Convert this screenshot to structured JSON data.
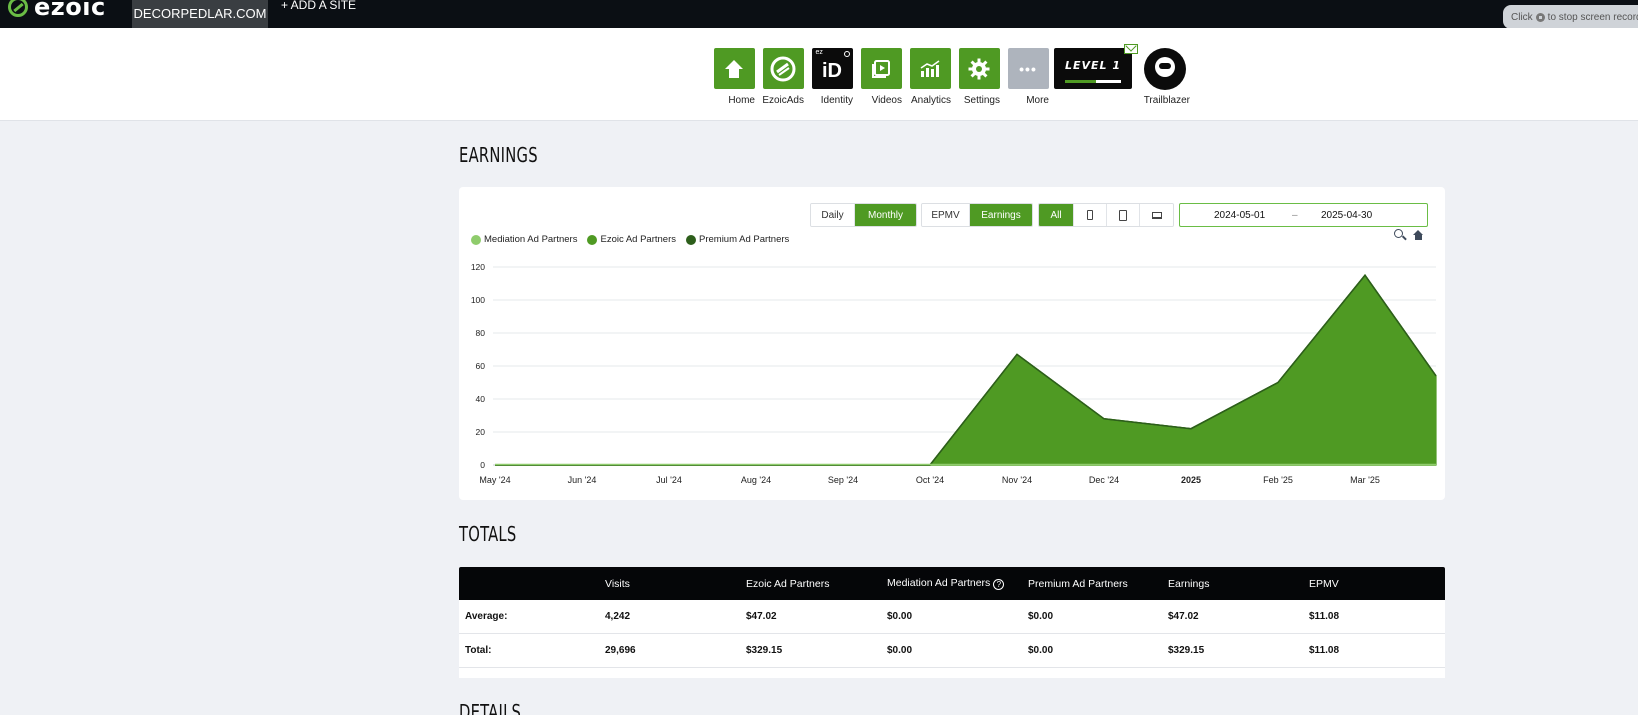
{
  "topbar": {
    "logo_text": "ezoic",
    "site": "DECORPEDLAR.COM",
    "add_site": "+ ADD A SITE",
    "recording_hint": "Click",
    "recording_hint_rest": "to stop screen record"
  },
  "nav": {
    "items": [
      {
        "label": "Home",
        "icon": "home-icon"
      },
      {
        "label": "EzoicAds",
        "icon": "ezoicads-icon"
      },
      {
        "label": "Identity",
        "icon": "identity-icon",
        "tile_text": "iD",
        "tile_sup": "ez"
      },
      {
        "label": "Videos",
        "icon": "video-icon"
      },
      {
        "label": "Analytics",
        "icon": "analytics-icon"
      },
      {
        "label": "Settings",
        "icon": "gear-icon"
      },
      {
        "label": "More",
        "icon": "more-icon",
        "tile_text": "•••"
      }
    ],
    "level": "LEVEL 1",
    "level_progress": 0.55,
    "trailblazer": "Trailblazer"
  },
  "earnings": {
    "title": "EARNINGS",
    "granularity": [
      "Daily",
      "Monthly"
    ],
    "granularity_selected": "Monthly",
    "metric": [
      "EPMV",
      "Earnings"
    ],
    "metric_selected": "Earnings",
    "device": [
      "All"
    ],
    "device_icons": [
      "mobile-icon",
      "tablet-icon",
      "desktop-icon"
    ],
    "date_start": "2024-05-01",
    "date_sep": "–",
    "date_end": "2025-04-30"
  },
  "chart_data": {
    "type": "area",
    "categories": [
      "May '24",
      "Jun '24",
      "Jul '24",
      "Aug '24",
      "Sep '24",
      "Oct '24",
      "Nov '24",
      "Dec '24",
      "2025",
      "Feb '25",
      "Mar '25",
      ""
    ],
    "series": [
      {
        "name": "Mediation Ad Partners",
        "color": "#8fcc6c",
        "values": [
          0,
          0,
          0,
          0,
          0,
          0,
          0,
          0,
          0,
          0,
          0,
          0
        ]
      },
      {
        "name": "Ezoic Ad Partners",
        "color": "#4f9a23",
        "values": [
          0,
          0,
          0,
          0,
          0,
          0,
          67,
          28,
          22,
          50,
          115,
          54
        ]
      },
      {
        "name": "Premium Ad Partners",
        "color": "#2d5e1b",
        "values": [
          0,
          0,
          0,
          0,
          0,
          0,
          0,
          0,
          0,
          0,
          0,
          0
        ]
      }
    ],
    "ylim": [
      0,
      120
    ],
    "yticks": [
      0,
      20,
      40,
      60,
      80,
      100,
      120
    ],
    "grid": true,
    "legend": "top-left"
  },
  "totals": {
    "title": "TOTALS",
    "columns": [
      "",
      "Visits",
      "Ezoic Ad Partners",
      "Mediation Ad Partners",
      "Premium Ad Partners",
      "Earnings",
      "EPMV"
    ],
    "rows": [
      [
        "Average:",
        "4,242",
        "$47.02",
        "$0.00",
        "$0.00",
        "$47.02",
        "$11.08"
      ],
      [
        "Total:",
        "29,696",
        "$329.15",
        "$0.00",
        "$0.00",
        "$329.15",
        "$11.08"
      ]
    ]
  },
  "details": {
    "title": "DETAILS"
  }
}
